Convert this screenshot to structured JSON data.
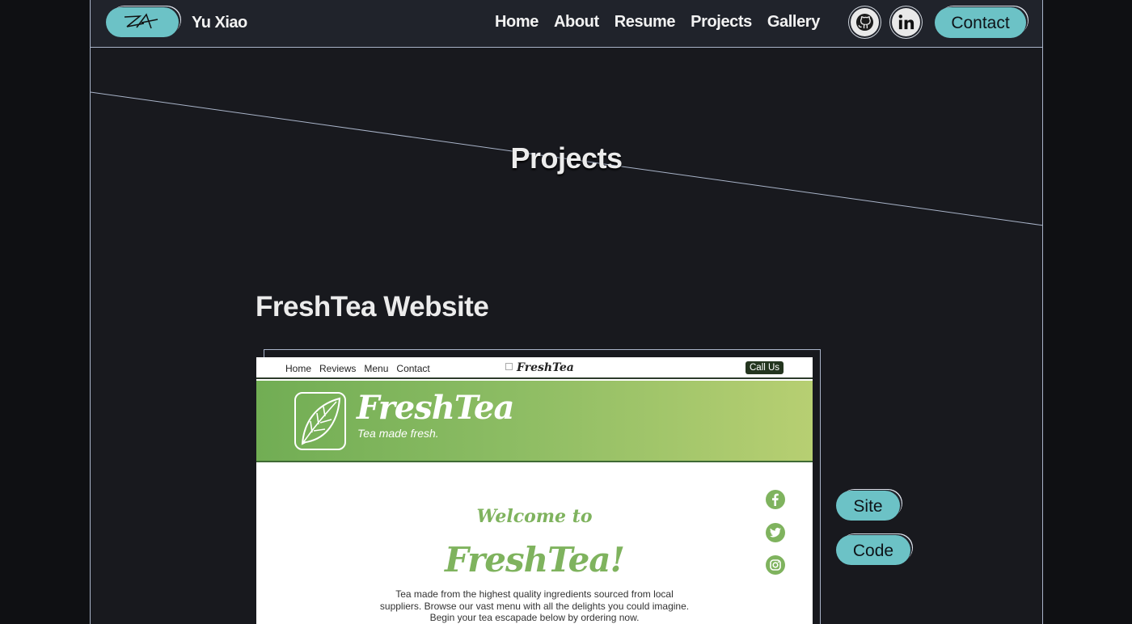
{
  "header": {
    "brand": "Yu Xiao",
    "logo_icon": "signature-logo",
    "nav": [
      "Home",
      "About",
      "Resume",
      "Projects",
      "Gallery"
    ],
    "social": [
      "github-icon",
      "linkedin-icon"
    ],
    "contact_label": "Contact",
    "accent": "#6cc2c6"
  },
  "hero": {
    "title": "Projects"
  },
  "project": {
    "title": "FreshTea Website",
    "buttons": {
      "site": "Site",
      "code": "Code"
    },
    "preview": {
      "nav_links": [
        "Home",
        "Reviews",
        "Menu",
        "Contact"
      ],
      "nav_brand": "FreshTea",
      "call_label": "Call Us",
      "banner_title": "FreshTea",
      "banner_tagline": "Tea made fresh.",
      "welcome": "Welcome to",
      "welcome_brand": "FreshTea!",
      "body_lines": [
        "Tea made from the highest quality ingredients sourced from local",
        "suppliers. Browse our vast menu with all the delights you could imagine.",
        "Begin your tea escapade below by ordering now."
      ],
      "social_icons": [
        "facebook-icon",
        "twitter-icon",
        "instagram-icon"
      ],
      "accent": "#7fb35e"
    }
  }
}
